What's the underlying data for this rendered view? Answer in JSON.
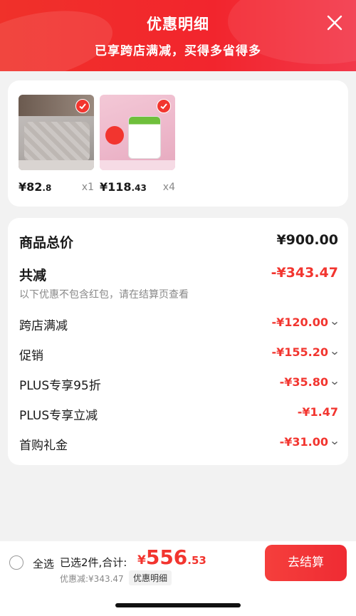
{
  "header": {
    "title": "优惠明细",
    "subtitle": "已享跨店满减，买得多省得多"
  },
  "products": [
    {
      "price_int": "¥82",
      "price_dec": ".8",
      "qty": "x1"
    },
    {
      "price_int": "¥118",
      "price_dec": ".43",
      "qty": "x4"
    }
  ],
  "summary": {
    "total_label": "商品总价",
    "total_value": "¥900.00",
    "reduce_label": "共减",
    "reduce_value": "-¥343.47",
    "note": "以下优惠不包含红包，请在结算页查看"
  },
  "items": [
    {
      "label": "跨店满减",
      "value": "-¥120.00"
    },
    {
      "label": "促销",
      "value": "-¥155.20"
    },
    {
      "label": "PLUS专享95折",
      "value": "-¥35.80"
    },
    {
      "label": "PLUS专享立减",
      "value": "-¥1.47"
    },
    {
      "label": "首购礼金",
      "value": "-¥31.00"
    }
  ],
  "bottom": {
    "select_all": "全选",
    "selected_info": "已选2件,合计:",
    "total_yen": "¥",
    "total_int": "556",
    "total_dec": ".53",
    "discount": "优惠减:¥343.47",
    "detail_tag": "优惠明细",
    "checkout": "去结算"
  },
  "colors": {
    "accent": "#f2352f"
  }
}
